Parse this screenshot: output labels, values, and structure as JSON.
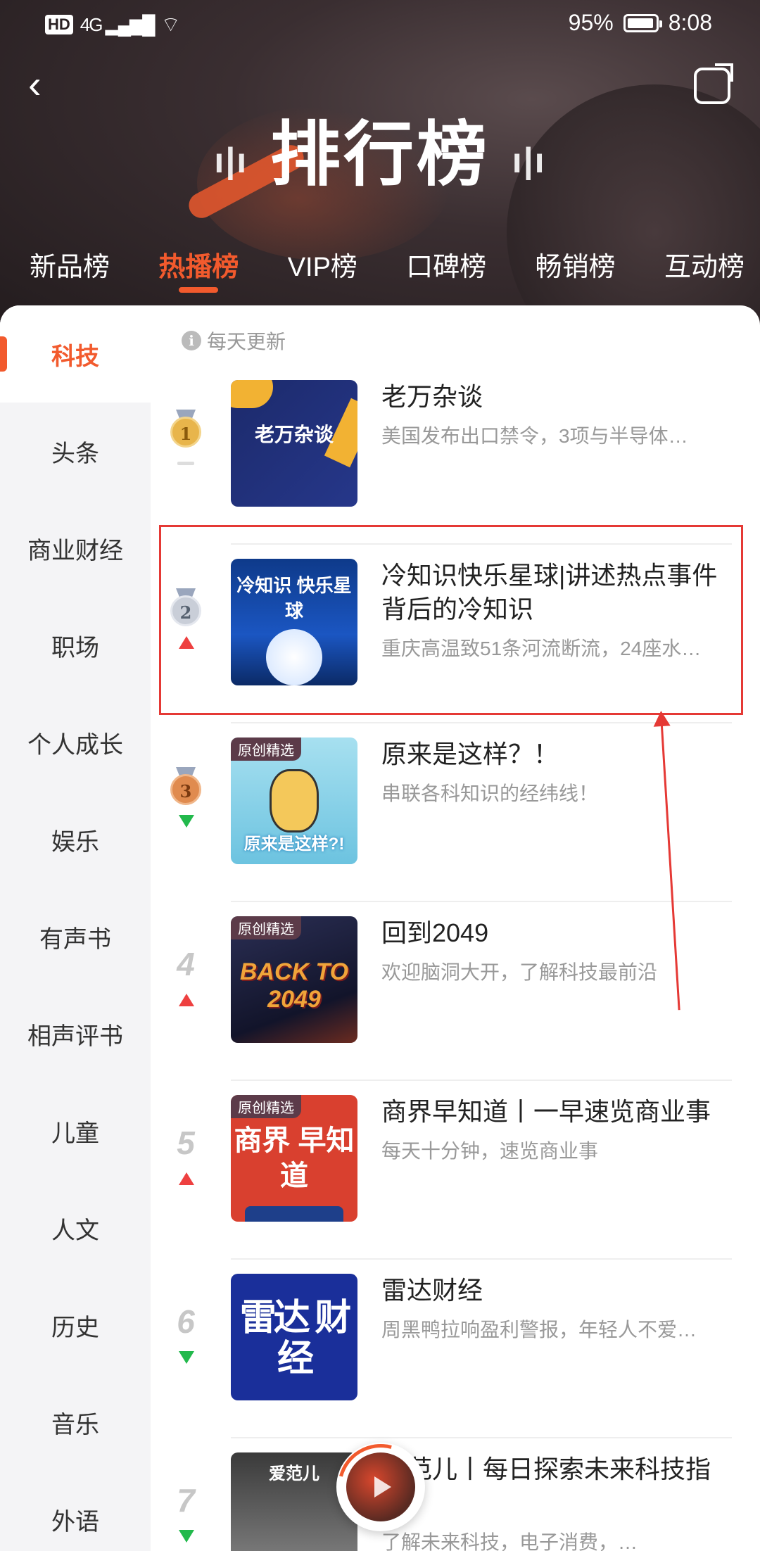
{
  "status": {
    "signal_label": "HD",
    "network": "4G",
    "battery": "95%",
    "time": "8:08"
  },
  "header": {
    "title": "排行榜",
    "tabs": [
      {
        "label": "新品榜"
      },
      {
        "label": "热播榜"
      },
      {
        "label": "VIP榜"
      },
      {
        "label": "口碑榜"
      },
      {
        "label": "畅销榜"
      },
      {
        "label": "互动榜"
      }
    ],
    "active_tab": "热播榜"
  },
  "sidebar": {
    "items": [
      {
        "label": "科技"
      },
      {
        "label": "头条"
      },
      {
        "label": "商业财经"
      },
      {
        "label": "职场"
      },
      {
        "label": "个人成长"
      },
      {
        "label": "娱乐"
      },
      {
        "label": "有声书"
      },
      {
        "label": "相声评书"
      },
      {
        "label": "儿童"
      },
      {
        "label": "人文"
      },
      {
        "label": "历史"
      },
      {
        "label": "音乐"
      },
      {
        "label": "外语"
      }
    ],
    "active": "科技"
  },
  "notice": "每天更新",
  "list": [
    {
      "rank": "1",
      "trend": "same",
      "title": "老万杂谈",
      "desc": "美国发布出口禁令，3项与半导体…",
      "cover_text": "老万杂谈",
      "cover_color": "#1c2a6b"
    },
    {
      "rank": "2",
      "trend": "up",
      "title": "冷知识快乐星球|讲述热点事件背后的冷知识",
      "desc": "重庆高温致51条河流断流，24座水…",
      "cover_text": "冷知识 快乐星球",
      "cover_color": "#123f8f"
    },
    {
      "rank": "3",
      "trend": "down",
      "title": "原来是这样？！",
      "desc": "串联各科知识的经纬线！",
      "cover_text": "原来是这样?!",
      "badge": "原创精选",
      "cover_color": "#8fd3ea"
    },
    {
      "rank": "4",
      "trend": "up",
      "title": "回到2049",
      "desc": "欢迎脑洞大开，了解科技最前沿",
      "cover_text": "BACK TO 2049",
      "badge": "原创精选",
      "cover_color": "#262a4a"
    },
    {
      "rank": "5",
      "trend": "up",
      "title": "商界早知道丨一早速览商业事",
      "desc": "每天十分钟，速览商业事",
      "cover_text": "商界 早知道",
      "badge": "原创精选",
      "cover_color": "#d9402f"
    },
    {
      "rank": "6",
      "trend": "down",
      "title": "雷达财经",
      "desc": "周黑鸭拉响盈利警报，年轻人不爱…",
      "cover_text": "雷达 财经",
      "cover_color": "#1a2f9a"
    },
    {
      "rank": "7",
      "trend": "down",
      "title": "爱范儿丨每日探索未来科技指南",
      "desc": "了解未来科技，电子消费，…",
      "cover_text": "爱范儿",
      "cover_color": "#3a3a3a"
    }
  ],
  "colors": {
    "accent": "#f25a2d",
    "up": "#ee4040",
    "down": "#22b94c",
    "highlight_box": "#e53935"
  }
}
